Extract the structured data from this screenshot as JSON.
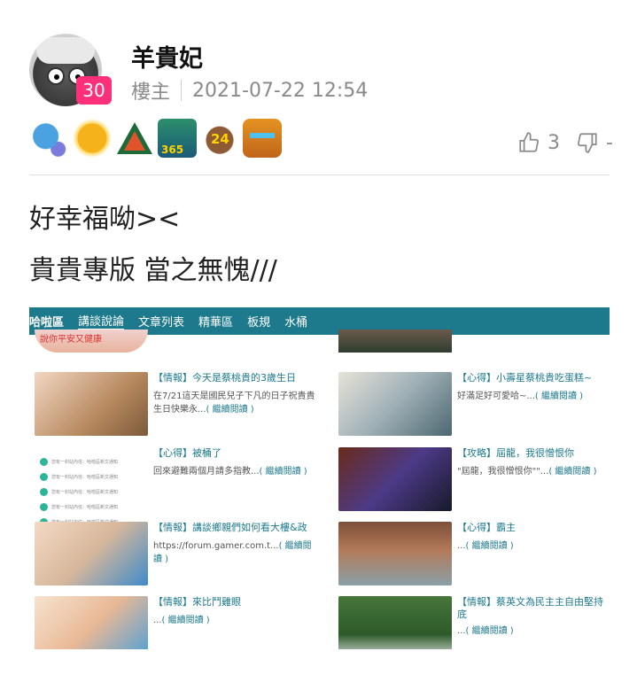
{
  "author": {
    "name": "羊貴妃",
    "level": "30",
    "role": "樓主",
    "timestamp": "2021-07-22 12:54"
  },
  "badges": [
    {
      "icon": "blue-gem-badge-icon"
    },
    {
      "icon": "gold-coin-badge-icon"
    },
    {
      "icon": "mountain-badge-icon"
    },
    {
      "icon": "365-badge-icon",
      "text": "365"
    },
    {
      "icon": "24-badge-icon",
      "text": "24"
    },
    {
      "icon": "treasure-chest-badge-icon"
    }
  ],
  "votes": {
    "up_count": "3",
    "down_count": "-"
  },
  "content": {
    "line1": "好幸福呦><",
    "line2": "貴貴專版 當之無愧///"
  },
  "embedded": {
    "nav": [
      "哈啦區",
      "講談說論",
      "文章列表",
      "精華區",
      "板規",
      "水桶"
    ],
    "top_left_caption": "說你平安又健康",
    "cards": [
      {
        "title": "【情報】今天是蔡桃貴的3歲生日",
        "desc": "在7/21這天是國民兒子下凡的日子祝貴貴生日快樂永...",
        "more": "( 繼續閱讀 )"
      },
      {
        "title": "【心得】小壽星蔡桃貴吃蛋糕~",
        "desc": "好滿足好可愛哈~...",
        "more": "( 繼續閱讀 )"
      },
      {
        "title": "【心得】被桶了",
        "desc": "回來避難兩個月請多指教...",
        "more": "( 繼續閱讀 )"
      },
      {
        "title": "【攻略】屆龍，我很憎恨你",
        "desc": "\"屆龍，我很憎恨你\"\"...",
        "more": "( 繼續閱讀 )"
      },
      {
        "title": "【情報】講談鄉親們如何看大樓&政",
        "desc": "https://forum.gamer.com.t...",
        "more": "( 繼續閱讀 )"
      },
      {
        "title": "【心得】霸主",
        "desc": "...",
        "more": "( 繼續閱讀 )"
      },
      {
        "title": "【情報】來比鬥雞眼",
        "desc": "...",
        "more": "( 繼續閱讀 )"
      },
      {
        "title": "【情報】蔡英文為民主主自由堅持底",
        "desc": "...",
        "more": "( 繼續閱讀 )"
      }
    ],
    "list_lines": [
      "您有一封站內信：哈啦區新文通知",
      "您有一封站內信：哈啦區新文通知",
      "您有一封站內信：哈啦區新文通知",
      "您有一封站內信：哈啦區新文通知",
      "您有一封站內信：哈啦區新文通知"
    ]
  },
  "colors": {
    "level_badge": "#ff2f7a",
    "nav_bar": "#1d7a8c",
    "link": "#1d7a8c"
  }
}
